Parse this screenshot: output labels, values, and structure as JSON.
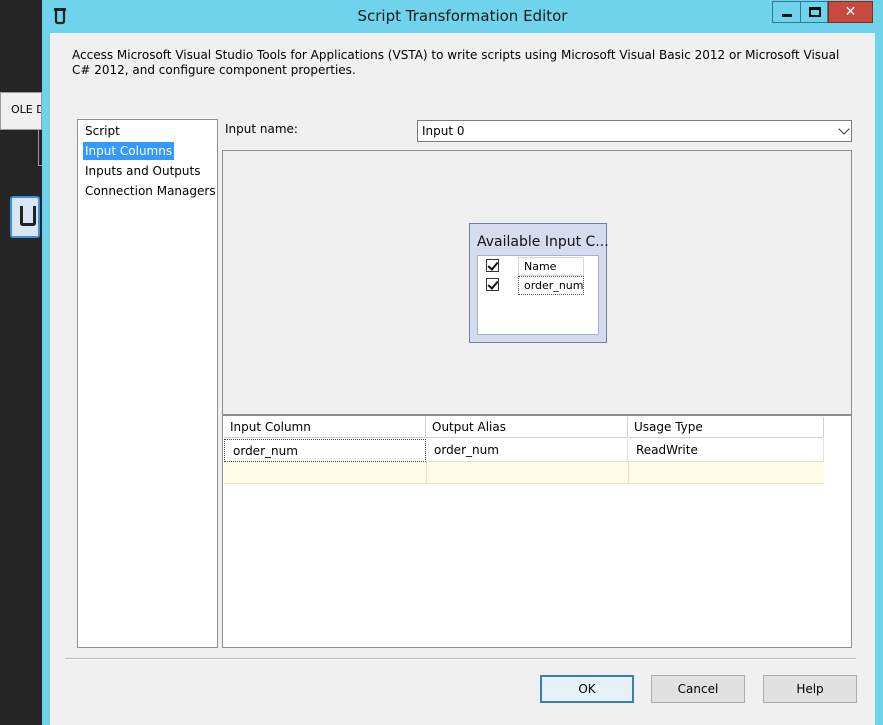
{
  "background": {
    "tab_label": "OLE D"
  },
  "window": {
    "title": "Script Transformation Editor",
    "icon": "script-component-icon",
    "controls": {
      "minimize": "minimize-icon",
      "maximize": "maximize-icon",
      "close": "✕"
    }
  },
  "description": "Access Microsoft Visual Studio Tools for Applications (VSTA) to write scripts using Microsoft Visual Basic 2012 or Microsoft Visual C# 2012, and configure component properties.",
  "nav": {
    "items": [
      {
        "label": "Script",
        "selected": false
      },
      {
        "label": "Input Columns",
        "selected": true
      },
      {
        "label": "Inputs and Outputs",
        "selected": false
      },
      {
        "label": "Connection Managers",
        "selected": false
      }
    ]
  },
  "input": {
    "label": "Input name:",
    "selected": "Input 0"
  },
  "available_columns": {
    "title": "Available Input C...",
    "rows": [
      {
        "label": "Name",
        "checked": true
      },
      {
        "label": "order_num",
        "checked": true
      }
    ]
  },
  "grid": {
    "headers": [
      "Input Column",
      "Output Alias",
      "Usage Type"
    ],
    "rows": [
      [
        "order_num",
        "order_num",
        "ReadWrite"
      ]
    ]
  },
  "buttons": {
    "ok": "OK",
    "cancel": "Cancel",
    "help": "Help"
  },
  "colors": {
    "titlebar": "#6fd3ec",
    "selection": "#3399ff",
    "close_button": "#c74a3f"
  }
}
